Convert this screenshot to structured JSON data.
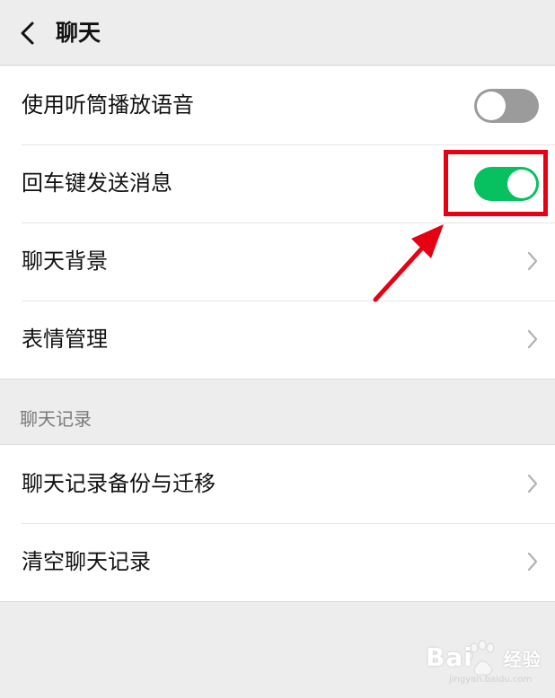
{
  "header": {
    "title": "聊天"
  },
  "settings_group": [
    {
      "label": "使用听筒播放语音",
      "control": "toggle",
      "enabled": false
    },
    {
      "label": "回车键发送消息",
      "control": "toggle",
      "enabled": true
    },
    {
      "label": "聊天背景",
      "control": "chevron"
    },
    {
      "label": "表情管理",
      "control": "chevron"
    }
  ],
  "chat_history_section": {
    "title": "聊天记录",
    "items": [
      {
        "label": "聊天记录备份与迁移",
        "control": "chevron"
      },
      {
        "label": "清空聊天记录",
        "control": "chevron"
      }
    ]
  },
  "colors": {
    "toggle_on": "#07c160",
    "toggle_off": "#9b9b9b",
    "annotation": "#e60012",
    "background": "#ededed"
  },
  "watermark": {
    "text": "Bai",
    "suffix": "经验",
    "url_text": "jingyan.baidu.com"
  }
}
